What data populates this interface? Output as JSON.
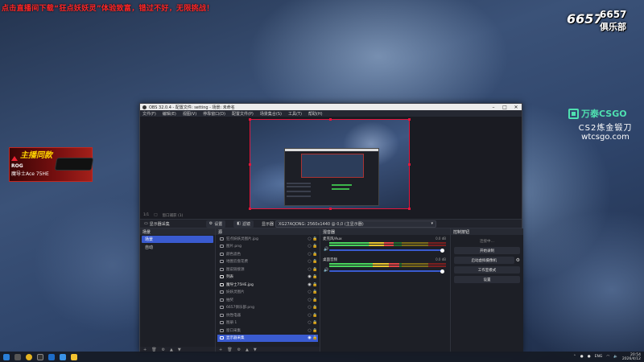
{
  "overlay": {
    "ticker": "点击直播间下载“狂点妖妖灵”体验致富，错过不好，无限挑战！",
    "club_num1": "6657",
    "club_num2": "6657",
    "club_name": "俱乐部",
    "brand_name": "万泰CSGO",
    "brand_sub": "CS2炼金锻刀",
    "brand_url": "wtcsgo.com",
    "promo_title": "主播同款",
    "promo_line1": "ROG",
    "promo_line2": "魔导士Ace 75HE",
    "colors": {
      "ticker": "#ff2626",
      "brand": "#4fe0b0",
      "promo": "#ffd400"
    }
  },
  "obs": {
    "window_title": "OBS 32.0.4 - 配置文件: setting - 场景: 未命名",
    "menu": [
      "文件(F)",
      "编辑(E)",
      "视图(V)",
      "停靠窗口(D)",
      "配置文件(P)",
      "场景集合(S)",
      "工具(T)",
      "帮助(H)"
    ],
    "preview_footer": [
      "1/1",
      "□",
      "窗口捕获 (1)"
    ],
    "toolbar": {
      "source_label": "显示器采集",
      "settings_label": "设置",
      "filters_label": "滤镜",
      "display_label": "显示器",
      "display_value": "XG27AQDNG: 2560x1440 @ 0,0 (主显示器)"
    },
    "scenes": {
      "header": "场景",
      "items": [
        "场景",
        "自动"
      ],
      "active_index": 0
    },
    "sources": {
      "header": "源",
      "items": [
        {
          "name": "狂点妖妖灵图片.jpg",
          "visible": false
        },
        {
          "name": "图片.png",
          "visible": false
        },
        {
          "name": "颜色滤色",
          "visible": false
        },
        {
          "name": "地图云盘花费",
          "visible": false
        },
        {
          "name": "图说链接源",
          "visible": false
        },
        {
          "name": "列表",
          "visible": true
        },
        {
          "name": "魔导士75HE.jpg",
          "visible": true
        },
        {
          "name": "妖妖灵图片",
          "visible": false
        },
        {
          "name": "抽奖",
          "visible": false
        },
        {
          "name": "6657俱乐部.png",
          "visible": false
        },
        {
          "name": "抗性电器",
          "visible": false
        },
        {
          "name": "图册 1",
          "visible": false
        },
        {
          "name": "窗口采集",
          "visible": false
        },
        {
          "name": "显示器采集",
          "visible": true
        }
      ],
      "active_index": 13
    },
    "mixer": {
      "header": "混音器",
      "channels": [
        {
          "name": "麦克风/Aux",
          "db": "0.0 dB",
          "level": 0.55
        },
        {
          "name": "桌面音频",
          "db": "0.0 dB",
          "level": 0.6
        }
      ]
    },
    "controls": {
      "header": "控制按钮",
      "status": "连接中…",
      "buttons": [
        "开始录制",
        "启动虚拟摄像机",
        "工作室模式",
        "设置"
      ]
    }
  },
  "taskbar": {
    "tray_lang": "ENG",
    "time": "20:54",
    "date": "2026/4/12"
  }
}
